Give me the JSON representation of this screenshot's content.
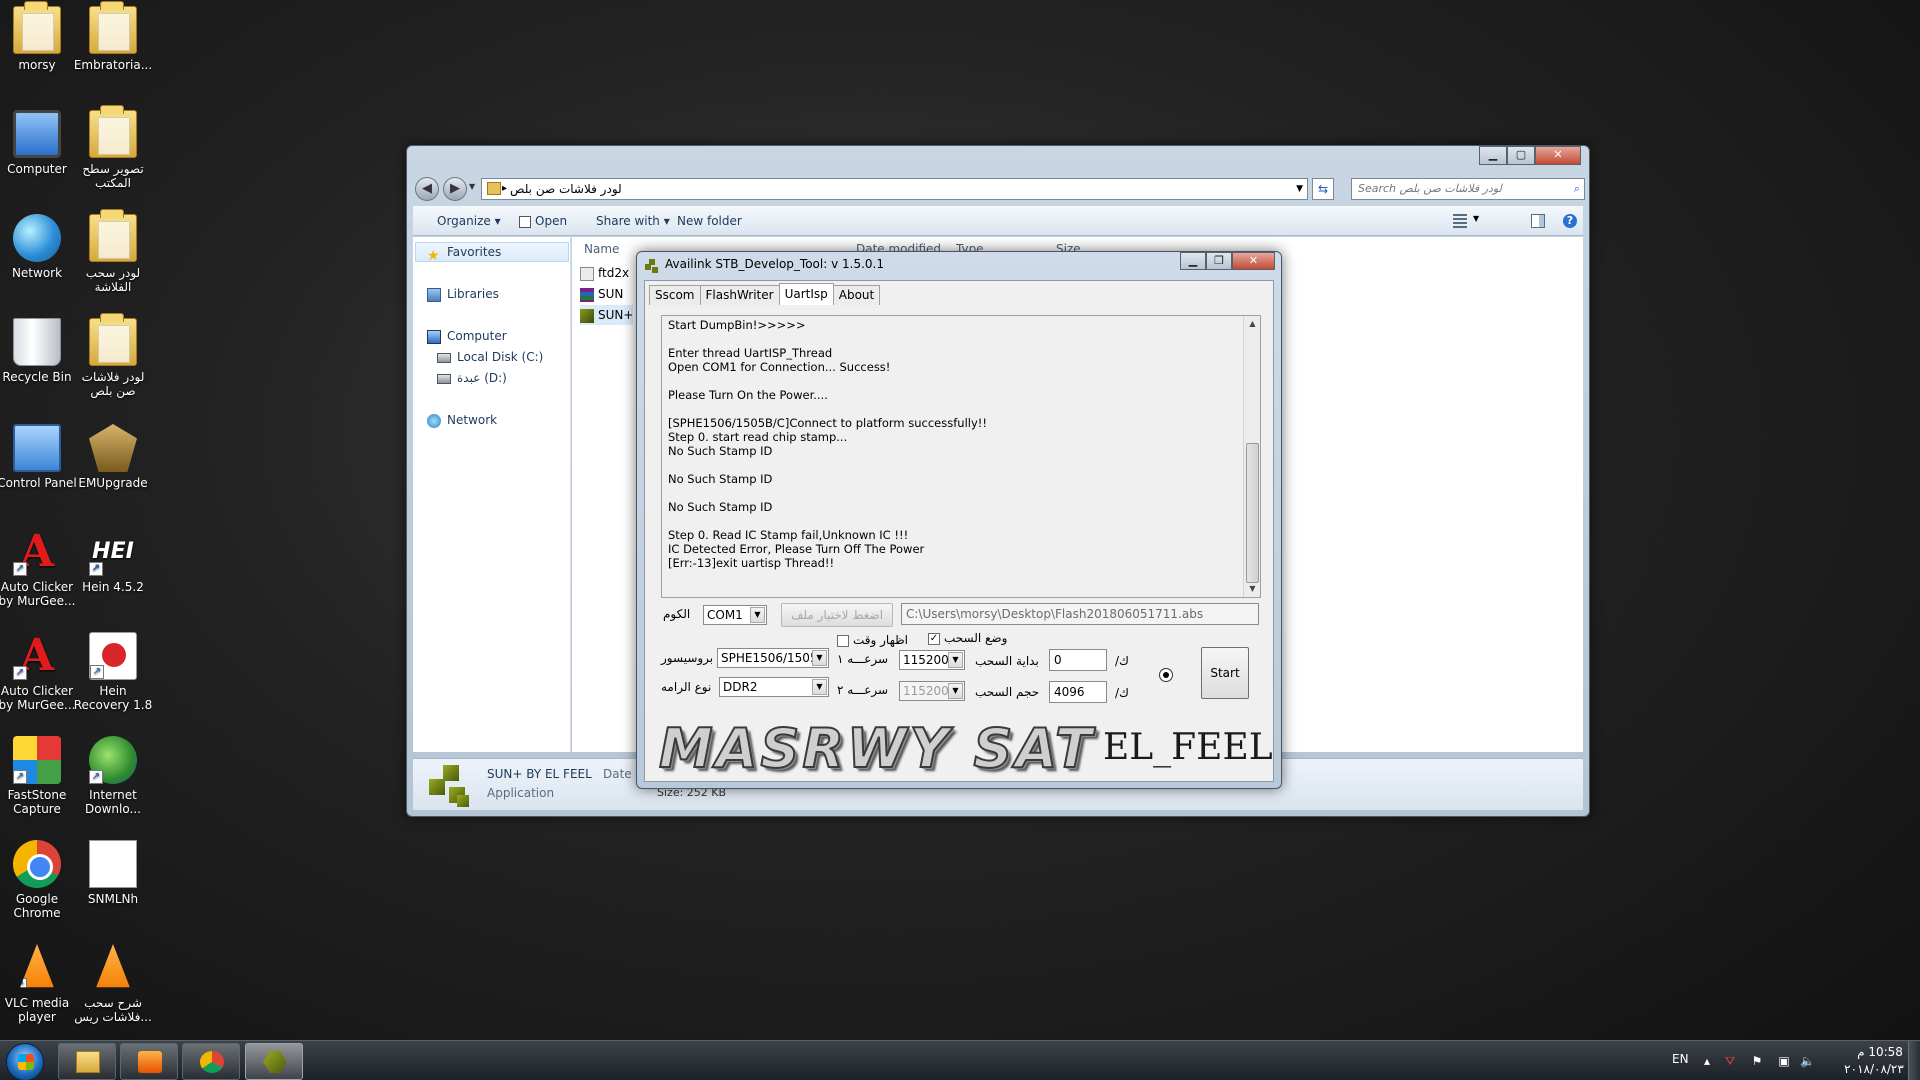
{
  "desktop": {
    "icons": [
      {
        "label": "morsy",
        "icon": "user-folder-icon"
      },
      {
        "label": "Embratoria...",
        "icon": "folder-icon"
      },
      {
        "label": "Computer",
        "icon": "computer-icon"
      },
      {
        "label": "تصوير سطح المكتب",
        "icon": "folder-icon"
      },
      {
        "label": "Network",
        "icon": "network-icon"
      },
      {
        "label": "لودر سحب الفلاشة",
        "icon": "folder-icon"
      },
      {
        "label": "Recycle Bin",
        "icon": "recycle-bin-icon"
      },
      {
        "label": "لودر فلاشات صن بلص",
        "icon": "folder-icon"
      },
      {
        "label": "Control Panel",
        "icon": "control-panel-icon"
      },
      {
        "label": "EMUpgrade",
        "icon": "emupgrade-icon"
      },
      {
        "label": "Auto Clicker by MurGee...",
        "icon": "auto-clicker-icon"
      },
      {
        "label": "Hein 4.5.2",
        "icon": "hei-icon"
      },
      {
        "label": "Auto Clicker by MurGee...",
        "icon": "auto-clicker-icon"
      },
      {
        "label": "Hein Recovery 1.8",
        "icon": "hein-recovery-icon"
      },
      {
        "label": "FastStone Capture",
        "icon": "faststone-icon"
      },
      {
        "label": "Internet Downlo...",
        "icon": "idm-icon"
      },
      {
        "label": "Google Chrome",
        "icon": "chrome-icon"
      },
      {
        "label": "SNMLNh",
        "icon": "snml-icon"
      },
      {
        "label": "VLC media player",
        "icon": "vlc-icon"
      },
      {
        "label": "شرح سحب فلاشات ريس...",
        "icon": "vlc-icon"
      }
    ]
  },
  "explorer": {
    "address_path": "لودر فلاشات صن بلص",
    "search_placeholder": "Search لودر فلاشات صن بلص",
    "toolbar": {
      "organize": "Organize",
      "open": "Open",
      "share_with": "Share with",
      "new_folder": "New folder"
    },
    "nav": {
      "favorites": "Favorites",
      "libraries": "Libraries",
      "computer": "Computer",
      "local_disk": "Local Disk (C:)",
      "drive_d": "عبدة (D:)",
      "network": "Network"
    },
    "columns": {
      "name": "Name",
      "date_modified": "Date modified",
      "type": "Type",
      "size": "Size"
    },
    "files": [
      {
        "name": "ftd2x",
        "icon": "ftd-file-icon"
      },
      {
        "name": "SUN",
        "icon": "rar-file-icon"
      },
      {
        "name": "SUN+",
        "icon": "sun-app-icon"
      }
    ],
    "details": {
      "name": "SUN+ BY EL FEEL",
      "type": "Application",
      "date_label": "Date mo",
      "size": "Size: 252 KB"
    }
  },
  "tool": {
    "title": "Availink STB_Develop_Tool: v 1.5.0.1",
    "tabs": [
      "Sscom",
      "FlashWriter",
      "UartIsp",
      "About"
    ],
    "active_tab": "UartIsp",
    "log": "Start DumpBin!>>>>>\n\nEnter thread UartISP_Thread\nOpen COM1 for Connection... Success!\n\nPlease Turn On the Power....\n\n[SPHE1506/1505B/C]Connect to platform successfully!!\nStep 0. start read chip stamp...\nNo Such Stamp ID\n\nNo Such Stamp ID\n\nNo Such Stamp ID\n\nStep 0. Read IC Stamp fail,Unknown IC !!!\nIC Detected Error, Please Turn Off The Power\n[Err:-13]exit uartisp Thread!!",
    "com_label": "الكوم",
    "com_value": "COM1",
    "choose_file_button": "اضغط لاختيار ملف",
    "file_path": "C:\\Users\\morsy\\Desktop\\Flash201806051711.abs",
    "show_time_label": "اظهار وقت",
    "show_time_checked": false,
    "pull_mode_label": "وضع السحب",
    "pull_mode_checked": true,
    "processor_label": "بروسيسور",
    "processor_value": "SPHE1506/1505",
    "speed1_label": "سرعـــه ١",
    "speed1_value": "115200",
    "start_label": "بداية السحب",
    "start_value": "0",
    "unit_label_1": "ك/",
    "memory_type_label": "نوع الرامه",
    "memory_type_value": "DDR2",
    "speed2_label": "سرعـــه ٢",
    "speed2_value": "115200",
    "size_label": "حجم السحب",
    "size_value": "4096",
    "unit_label_2": "ك/",
    "start_button": "Start",
    "banner_big": "MASRWY  SAT",
    "banner_small": "EL_FEEL"
  },
  "taskbar": {
    "language": "EN",
    "time": "10:58 م",
    "date": "٢٠١٨/٠٨/٢٣"
  }
}
